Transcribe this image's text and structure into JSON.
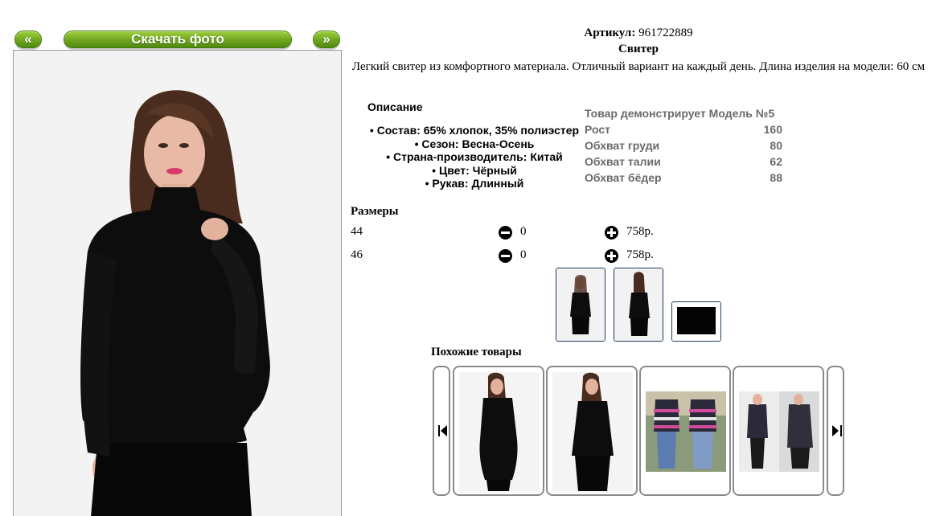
{
  "viewer": {
    "prev_label": "«",
    "download_label": "Скачать фото",
    "next_label": "»"
  },
  "product": {
    "sku_label": "Артикул:",
    "sku_value": "961722889",
    "name": "Свитер",
    "description": "Легкий свитер из комфортного материала. Отличный вариант на каждый день. Длина изделия на модели: 60 см"
  },
  "details": {
    "heading": "Описание",
    "attributes": [
      "Состав: 65% хлопок, 35% полиэстер",
      "Сезон: Весна-Осень",
      "Страна-производитель: Китай",
      "Цвет: Чёрный",
      "Рукав: Длинный"
    ]
  },
  "model": {
    "heading": "Товар демонстрирует Модель №5",
    "rows": [
      {
        "label": "Рост",
        "value": "160"
      },
      {
        "label": "Обхват груди",
        "value": "80"
      },
      {
        "label": "Обхват талии",
        "value": "62"
      },
      {
        "label": "Обхват бёдер",
        "value": "88"
      }
    ]
  },
  "sizes": {
    "title": "Размеры",
    "rows": [
      {
        "size": "44",
        "qty": "0",
        "price": "758р."
      },
      {
        "size": "46",
        "qty": "0",
        "price": "758р."
      }
    ]
  },
  "similar": {
    "title": "Похожие товары"
  },
  "colors": {
    "button_green": "#6fa51e",
    "thumb_border": "#1f3b5c",
    "card_border": "#8a8a8a",
    "garment": "#0d0d0d"
  }
}
